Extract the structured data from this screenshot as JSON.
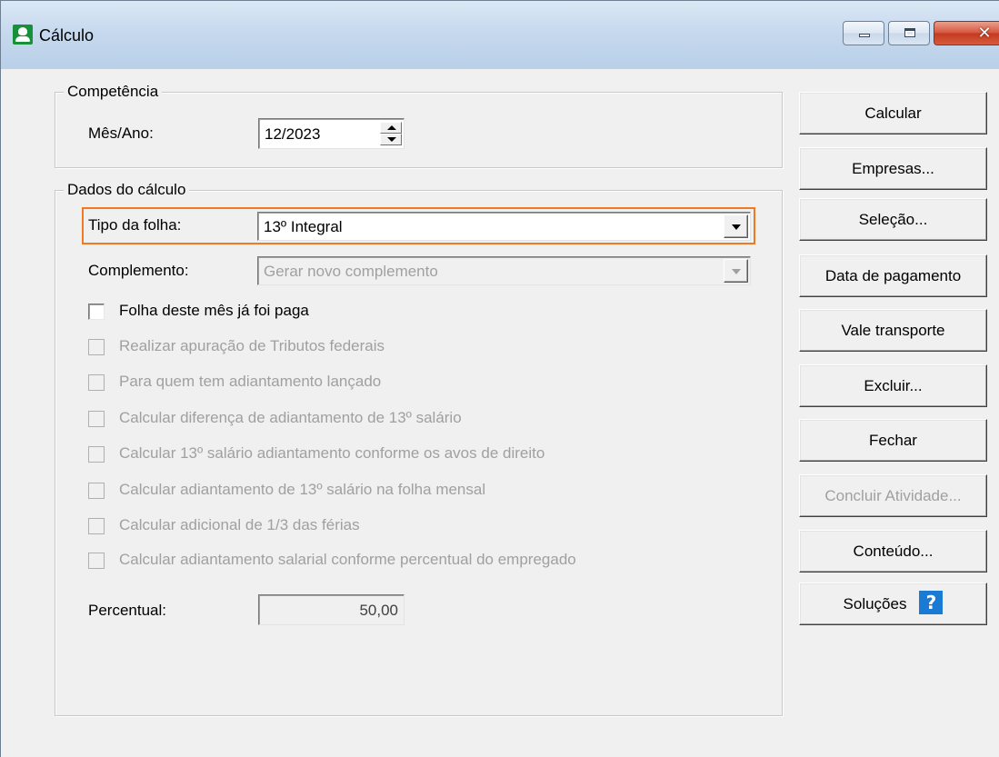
{
  "window": {
    "title": "Cálculo"
  },
  "competencia": {
    "legend": "Competência",
    "mes_ano_label": "Mês/Ano:",
    "mes_ano_value": "12/2023"
  },
  "dados": {
    "legend": "Dados do cálculo",
    "tipo_folha_label": "Tipo da folha:",
    "tipo_folha_value": "13º Integral",
    "complemento_label": "Complemento:",
    "complemento_value": "Gerar novo complemento",
    "checkboxes": [
      {
        "label": "Folha deste mês já foi paga",
        "checked": false,
        "enabled": true
      },
      {
        "label": "Realizar apuração de Tributos federais",
        "checked": false,
        "enabled": false
      },
      {
        "label": "Para quem tem adiantamento lançado",
        "checked": false,
        "enabled": false
      },
      {
        "label": "Calcular diferença de adiantamento de 13º salário",
        "checked": false,
        "enabled": false
      },
      {
        "label": "Calcular 13º salário adiantamento conforme os avos de direito",
        "checked": false,
        "enabled": false
      },
      {
        "label": "Calcular adiantamento de 13º salário na folha mensal",
        "checked": false,
        "enabled": false
      },
      {
        "label": "Calcular adicional de 1/3 das férias",
        "checked": false,
        "enabled": false
      },
      {
        "label": "Calcular adiantamento salarial conforme percentual do empregado",
        "checked": false,
        "enabled": false
      }
    ],
    "percentual_label": "Percentual:",
    "percentual_value": "50,00"
  },
  "buttons": {
    "calcular": "Calcular",
    "empresas": "Empresas...",
    "selecao": "Seleção...",
    "data_pagamento": "Data de pagamento",
    "vale_transporte": "Vale transporte",
    "excluir": "Excluir...",
    "fechar": "Fechar",
    "concluir": "Concluir Atividade...",
    "conteudo": "Conteúdo...",
    "solucoes": "Soluções",
    "help_glyph": "?"
  },
  "colors": {
    "highlight": "#f07a24",
    "help_icon": "#1a7ad4",
    "app_icon": "#169139"
  },
  "icons": {
    "app": "user-icon",
    "help": "question-icon"
  }
}
